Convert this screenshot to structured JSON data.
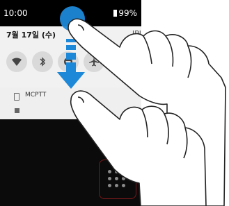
{
  "status_bar": {
    "time": "10:00",
    "battery_text": "99%"
  },
  "shade": {
    "date": "7월 17일 (수)",
    "date_partial_right": "IPI",
    "tiles": [
      "wifi-icon",
      "bluetooth-icon",
      "do-not-disturb-icon",
      "airplane-icon"
    ]
  },
  "notification": {
    "app_name": "MCPTT"
  },
  "colors": {
    "accent_blue": "#1e88d8",
    "shade_bg": "#f1f1f1",
    "hand_outline": "#222222"
  }
}
